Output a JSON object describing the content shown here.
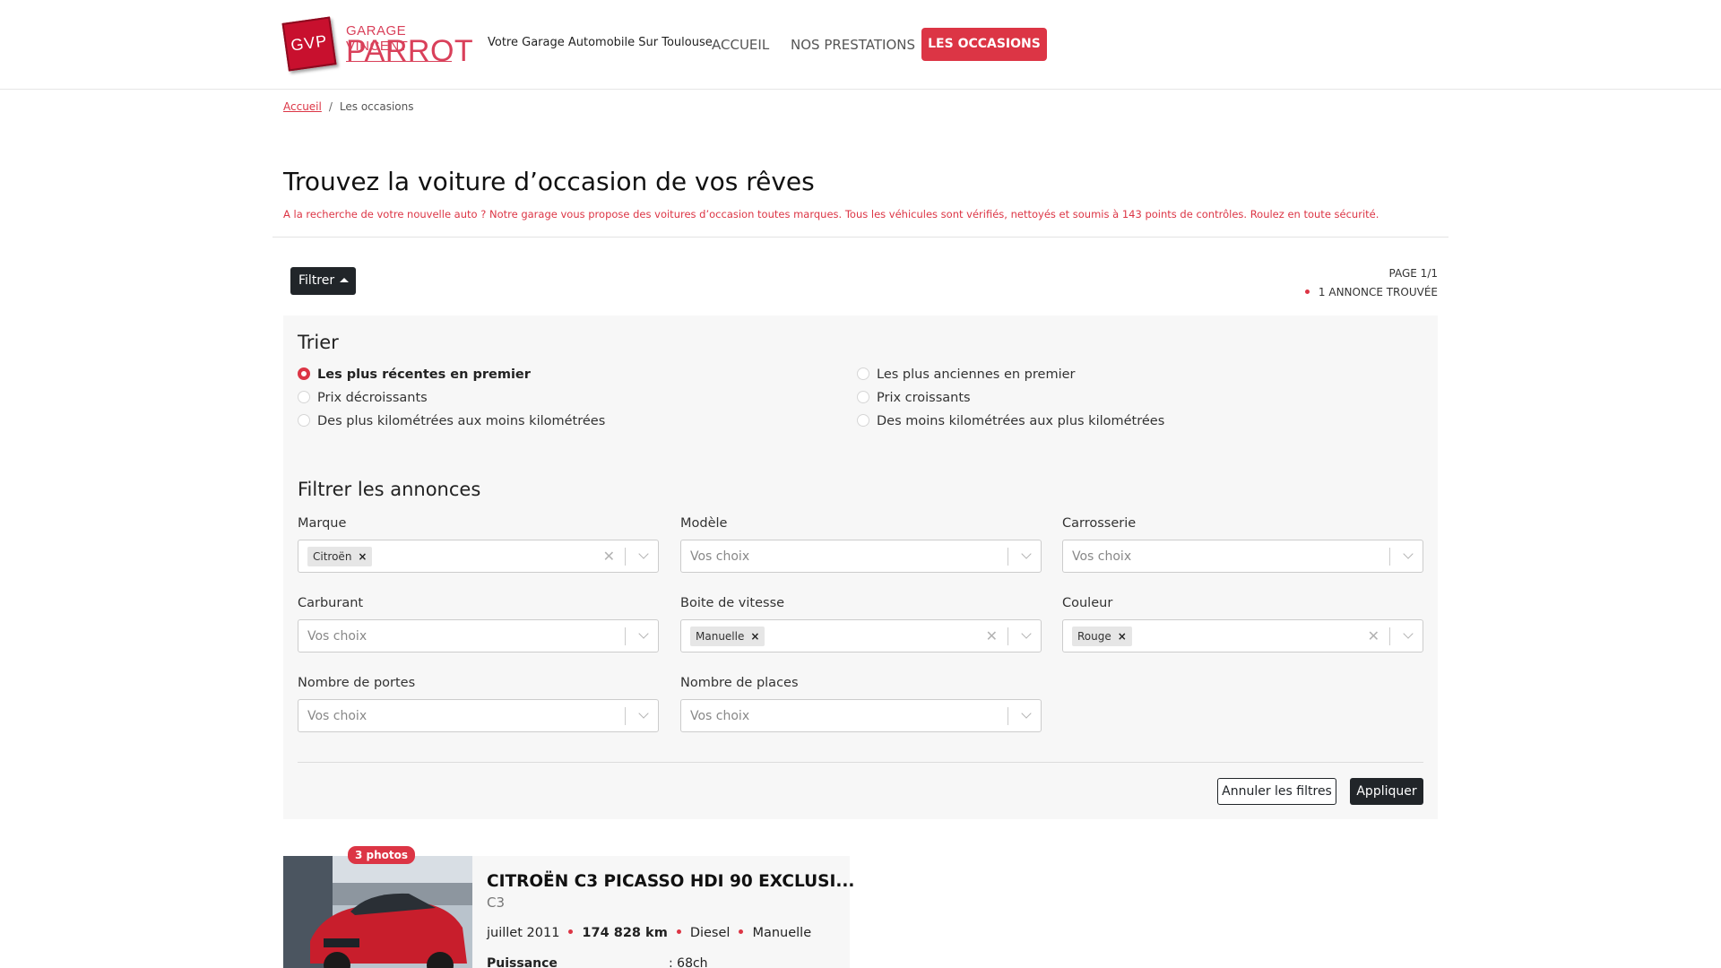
{
  "header": {
    "logo_line1": "GARAGE VINCENT",
    "logo_line2": "PARROT",
    "logo_mark": "GVP",
    "tagline": "Votre Garage Automobile Sur Toulouse.",
    "nav": {
      "accueil": "ACCUEIL",
      "prestations": "NOS PRESTATIONS",
      "occasions": "LES OCCASIONS"
    },
    "accent_color": "#dc3545"
  },
  "breadcrumb": {
    "home": "Accueil",
    "separator": "/",
    "current": "Les occasions"
  },
  "page": {
    "title": "Trouvez la voiture d’occasion de vos rêves",
    "subtitle": "A la recherche de votre nouvelle auto ? Notre garage vous propose des voitures d’occasion toutes marques. Tous les véhicules sont vérifiés, nettoyés et soumis à 143 points de contrôles. Roulez en toute sécurité."
  },
  "toolbar": {
    "filter_button": "Filtrer",
    "page_label": "PAGE 1/1",
    "results_label": "1 ANNONCE TROUVÉE"
  },
  "sort": {
    "title": "Trier",
    "options": [
      {
        "label": "Les plus récentes en premier",
        "checked": true
      },
      {
        "label": "Les plus anciennes en premier",
        "checked": false
      },
      {
        "label": "Prix décroissants",
        "checked": false
      },
      {
        "label": "Prix croissants",
        "checked": false
      },
      {
        "label": "Des plus kilométrées aux moins kilométrées",
        "checked": false
      },
      {
        "label": "Des moins kilométrées aux plus kilométrées",
        "checked": false
      }
    ]
  },
  "filters": {
    "title": "Filtrer les annonces",
    "placeholder": "Vos choix",
    "fields": [
      {
        "label": "Marque",
        "value": "Citroën"
      },
      {
        "label": "Modèle",
        "value": ""
      },
      {
        "label": "Carrosserie",
        "value": ""
      },
      {
        "label": "Carburant",
        "value": ""
      },
      {
        "label": "Boite de vitesse",
        "value": "Manuelle"
      },
      {
        "label": "Couleur",
        "value": "Rouge"
      },
      {
        "label": "Nombre de portes",
        "value": ""
      },
      {
        "label": "Nombre de places",
        "value": ""
      }
    ],
    "cancel_label": "Annuler les filtres",
    "apply_label": "Appliquer"
  },
  "listing": {
    "photo_badge": "3 photos",
    "title": "CITROËN C3 PICASSO HDI 90 EXCLUSI...",
    "model": "C3",
    "date": "juillet 2011",
    "mileage": "174 828 km",
    "fuel": "Diesel",
    "gearbox": "Manuelle",
    "spec_label": "Puissance",
    "spec_value": ": 68ch"
  }
}
